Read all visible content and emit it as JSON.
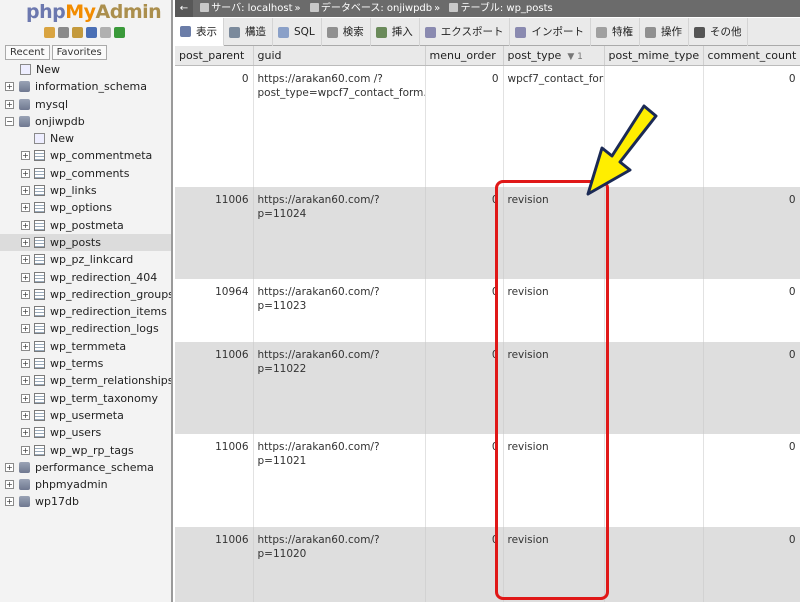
{
  "logo": {
    "php": "php",
    "my": "My",
    "admin": "Admin"
  },
  "nav_icons": [
    {
      "name": "home-icon",
      "color": "#d9a441"
    },
    {
      "name": "exit-icon",
      "color": "#8a8a8a"
    },
    {
      "name": "query-icon",
      "color": "#c49a3c"
    },
    {
      "name": "help-icon",
      "color": "#4a6fb5"
    },
    {
      "name": "docs-icon",
      "color": "#b0b0b0"
    },
    {
      "name": "reload-icon",
      "color": "#3a9a3a"
    }
  ],
  "nav_tabs": [
    "Recent",
    "Favorites"
  ],
  "tree": {
    "top_new": "New",
    "dbs_before": [
      "information_schema",
      "mysql"
    ],
    "open_db": "onjiwpdb",
    "open_db_new": "New",
    "tables": [
      "wp_commentmeta",
      "wp_comments",
      "wp_links",
      "wp_options",
      "wp_postmeta",
      "wp_posts",
      "wp_pz_linkcard",
      "wp_redirection_404",
      "wp_redirection_groups",
      "wp_redirection_items",
      "wp_redirection_logs",
      "wp_termmeta",
      "wp_terms",
      "wp_term_relationships",
      "wp_term_taxonomy",
      "wp_usermeta",
      "wp_users",
      "wp_wp_rp_tags"
    ],
    "selected_table": "wp_posts",
    "dbs_after": [
      "performance_schema",
      "phpmyadmin",
      "wp17db"
    ]
  },
  "breadcrumb": {
    "server": "サーバ: localhost",
    "database": "データベース: onjiwpdb",
    "table": "テーブル: wp_posts"
  },
  "tabs": [
    {
      "label": "表示",
      "icon": "browse-icon",
      "color": "#6b7da8",
      "active": true
    },
    {
      "label": "構造",
      "icon": "structure-icon",
      "color": "#7b8a9c"
    },
    {
      "label": "SQL",
      "icon": "sql-icon",
      "color": "#8aa0c8"
    },
    {
      "label": "検索",
      "icon": "search-icon",
      "color": "#909090"
    },
    {
      "label": "挿入",
      "icon": "insert-icon",
      "color": "#6a8a5a"
    },
    {
      "label": "エクスポート",
      "icon": "export-icon",
      "color": "#8a8ab0"
    },
    {
      "label": "インポート",
      "icon": "import-icon",
      "color": "#8a8ab0"
    },
    {
      "label": "特権",
      "icon": "privileges-icon",
      "color": "#a0a0a0"
    },
    {
      "label": "操作",
      "icon": "operations-icon",
      "color": "#909090"
    },
    {
      "label": "その他",
      "icon": "more-icon",
      "color": "#555555"
    }
  ],
  "table": {
    "columns": [
      "post_parent",
      "guid",
      "menu_order",
      "post_type",
      "post_mime_type",
      "comment_count"
    ],
    "sort_indicator": "▼ 1",
    "rows": [
      {
        "post_parent": "0",
        "guid": "https://arakan60.com /?post_type=wpcf7_contact_form…",
        "menu_order": "0",
        "post_type": "wpcf7_contact_form",
        "post_mime_type": "",
        "comment_count": "0"
      },
      {
        "post_parent": "11006",
        "guid": "https://arakan60.com/?p=11024",
        "menu_order": "0",
        "post_type": "revision",
        "post_mime_type": "",
        "comment_count": "0"
      },
      {
        "post_parent": "10964",
        "guid": "https://arakan60.com/?p=11023",
        "menu_order": "0",
        "post_type": "revision",
        "post_mime_type": "",
        "comment_count": "0"
      },
      {
        "post_parent": "11006",
        "guid": "https://arakan60.com/?p=11022",
        "menu_order": "0",
        "post_type": "revision",
        "post_mime_type": "",
        "comment_count": "0"
      },
      {
        "post_parent": "11006",
        "guid": "https://arakan60.com/?p=11021",
        "menu_order": "0",
        "post_type": "revision",
        "post_mime_type": "",
        "comment_count": "0"
      },
      {
        "post_parent": "11006",
        "guid": "https://arakan60.com/?p=11020",
        "menu_order": "0",
        "post_type": "revision",
        "post_mime_type": "",
        "comment_count": "0"
      }
    ]
  },
  "annotation": {
    "highlight_color": "#e01818",
    "arrow_color": "#ffee00"
  }
}
